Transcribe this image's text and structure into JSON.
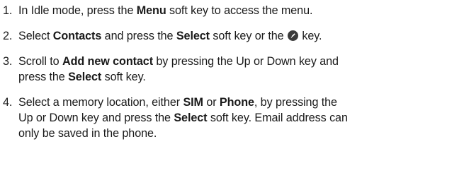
{
  "steps": [
    {
      "number": "1.",
      "t1": "In Idle mode, press the ",
      "b1": "Menu",
      "t2": " soft key to access the menu."
    },
    {
      "number": "2.",
      "t1": "Select ",
      "b1": "Contacts",
      "t2": " and press the ",
      "b2": "Select",
      "t3": " soft key or the ",
      "icon": "ok-key-icon",
      "t4": " key."
    },
    {
      "number": "3.",
      "t1": "Scroll to ",
      "b1": "Add new contact",
      "t2": " by pressing the Up or Down key and",
      "t3": "press the ",
      "b2": "Select",
      "t4": " soft key."
    },
    {
      "number": "4.",
      "t1": "Select a memory location, either ",
      "b1": "SIM",
      "t2": " or ",
      "b2": "Phone",
      "t3": ", by pressing the",
      "t4": "Up or Down key and press the ",
      "b3": "Select",
      "t5": " soft key. Email address can",
      "t6": "only be saved in the phone."
    }
  ]
}
